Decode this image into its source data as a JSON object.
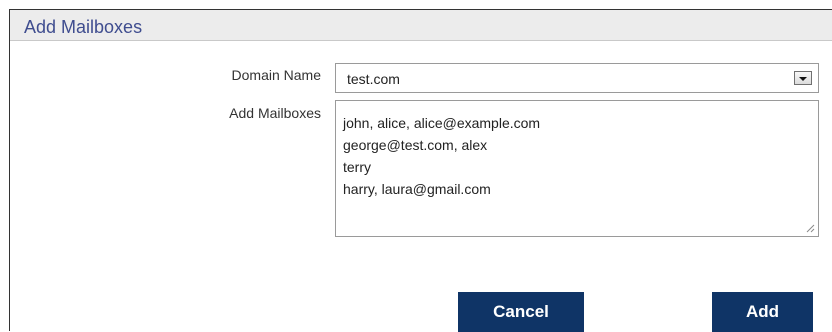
{
  "dialog": {
    "title": "Add Mailboxes"
  },
  "form": {
    "domain_label": "Domain Name",
    "domain_value": "test.com",
    "mailboxes_label": "Add Mailboxes",
    "mailboxes_lines": [
      "john, alice, alice@example.com",
      "george@test.com, alex",
      "terry",
      "harry, laura@gmail.com"
    ]
  },
  "actions": {
    "cancel_label": "Cancel",
    "add_label": "Add"
  },
  "colors": {
    "title_text": "#3f4d8f",
    "header_bg": "#ececec",
    "button_bg": "#0f3466",
    "button_text": "#ffffff"
  }
}
